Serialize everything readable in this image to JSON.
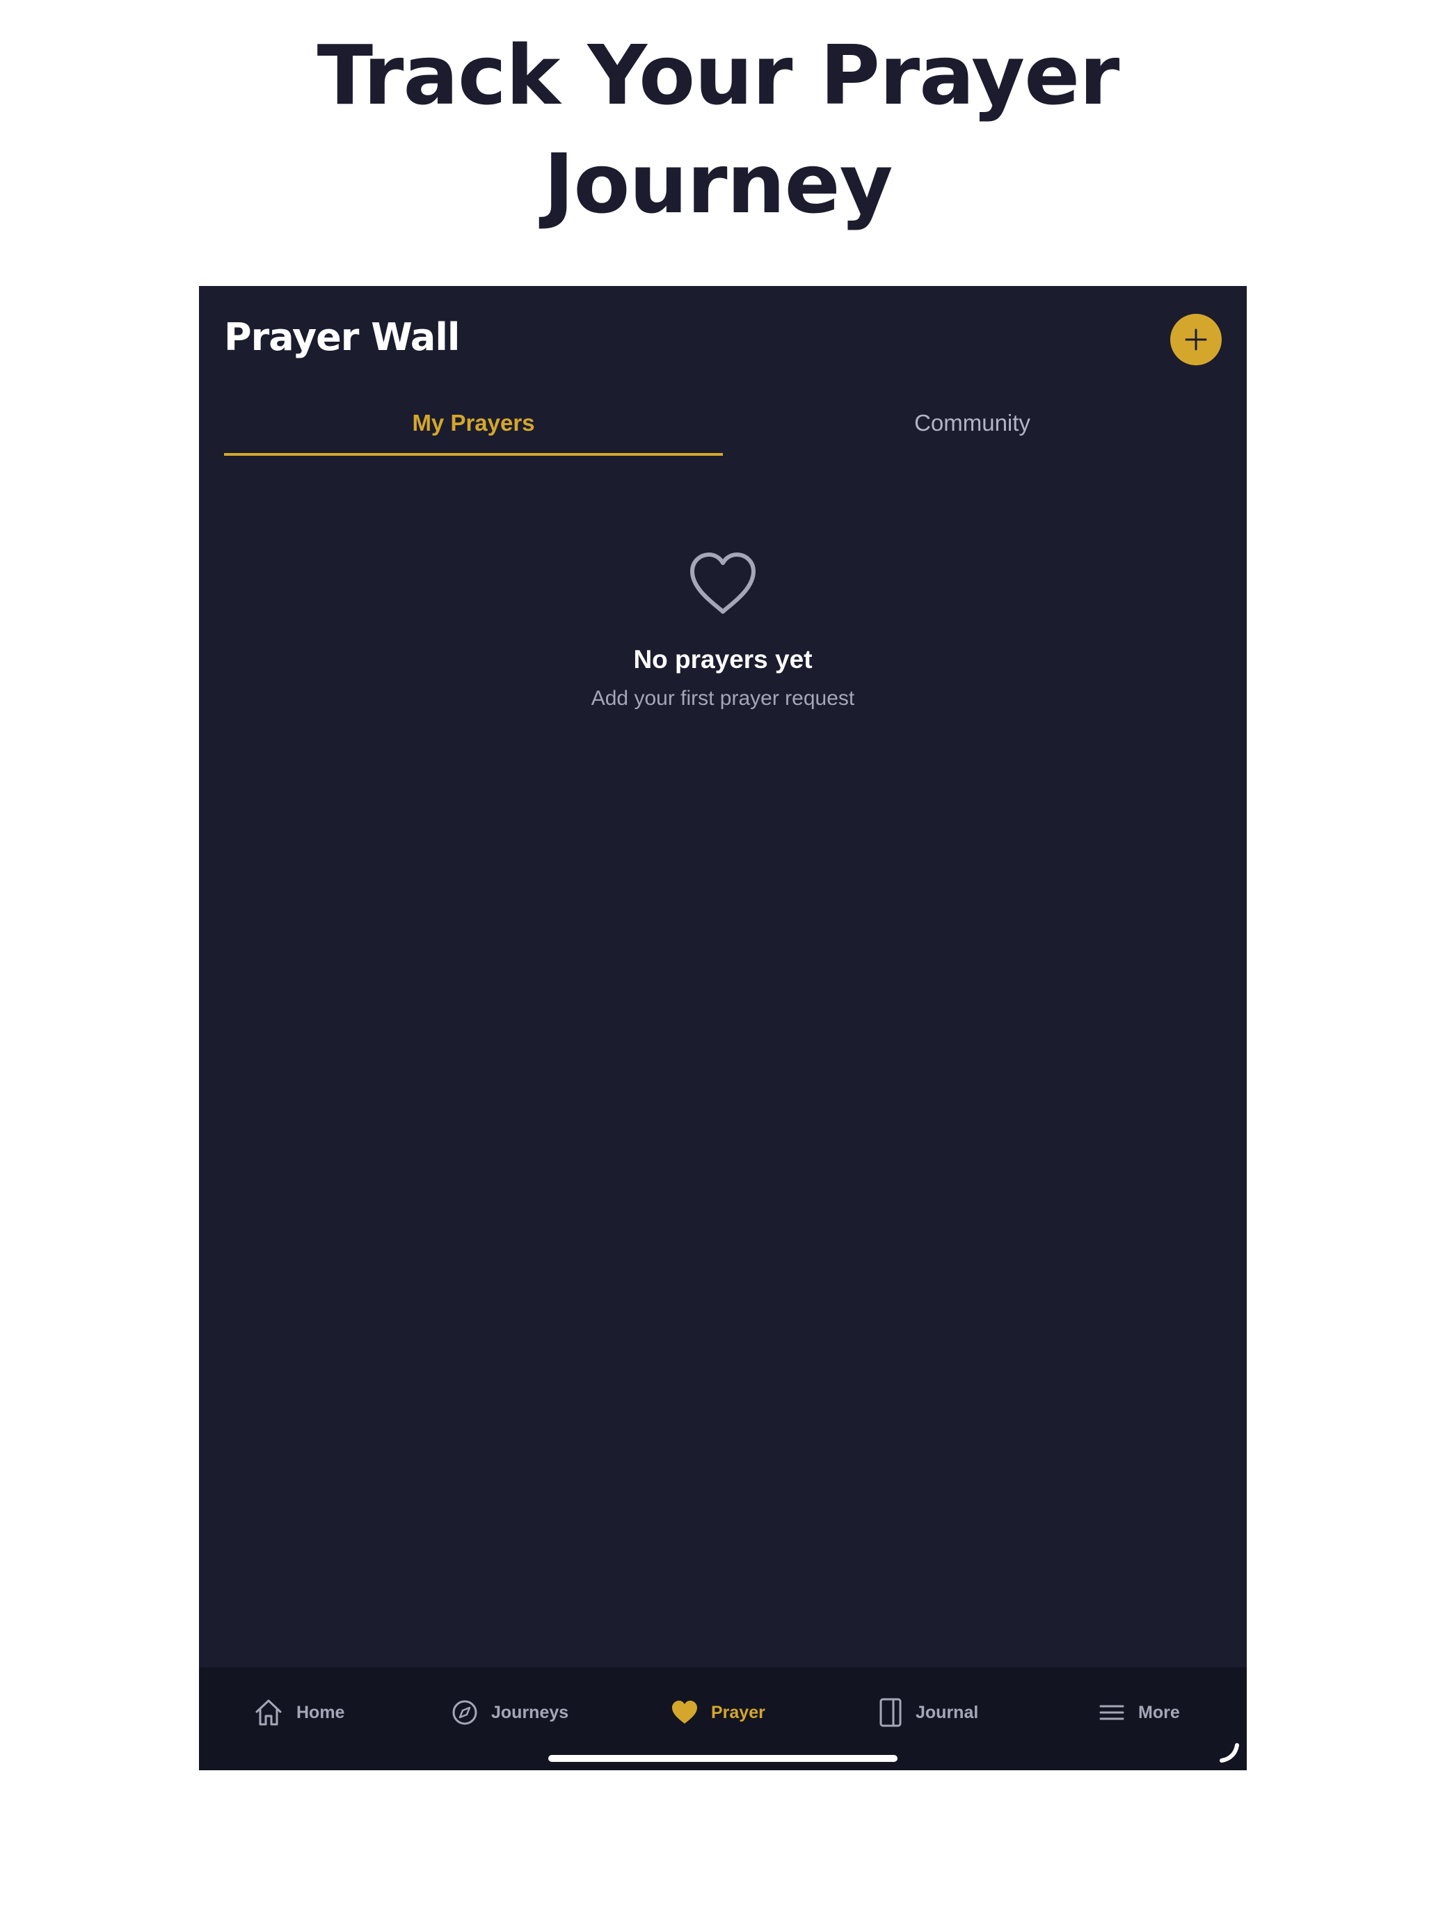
{
  "headline": {
    "line1": "Track Your Prayer",
    "line2": "Journey"
  },
  "header": {
    "title": "Prayer Wall",
    "add_icon": "plus-icon"
  },
  "tabs": [
    {
      "label": "My Prayers",
      "active": true
    },
    {
      "label": "Community",
      "active": false
    }
  ],
  "empty_state": {
    "icon": "heart-outline-icon",
    "title": "No prayers yet",
    "subtitle": "Add your first prayer request"
  },
  "tab_bar": [
    {
      "label": "Home",
      "icon": "home-icon",
      "active": false
    },
    {
      "label": "Journeys",
      "icon": "compass-icon",
      "active": false
    },
    {
      "label": "Prayer",
      "icon": "heart-icon",
      "active": true
    },
    {
      "label": "Journal",
      "icon": "journal-icon",
      "active": false
    },
    {
      "label": "More",
      "icon": "menu-icon",
      "active": false
    }
  ],
  "colors": {
    "accent": "#d4a72c",
    "background": "#1b1c2e",
    "tab_bar": "#131421",
    "muted_text": "#a5a7b8",
    "headline": "#1c1c2e"
  }
}
